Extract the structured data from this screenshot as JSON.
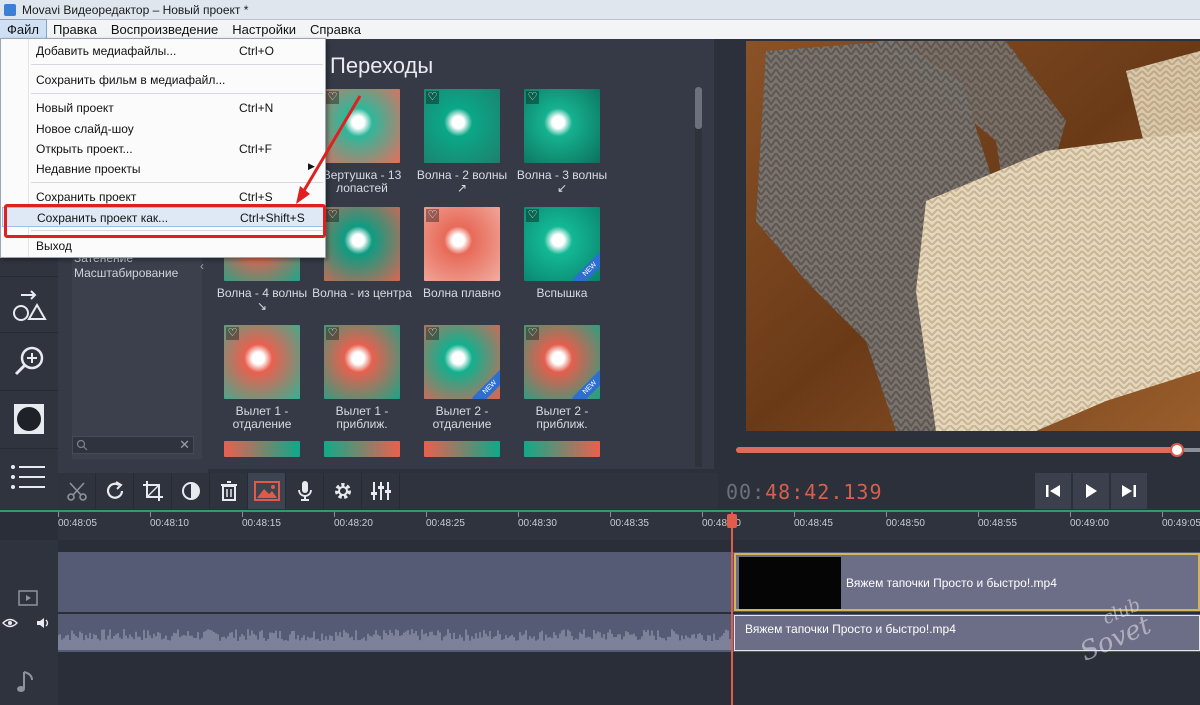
{
  "window": {
    "title": "Movavi Видеоредактор – Новый проект *"
  },
  "menubar": {
    "items": [
      "Файл",
      "Правка",
      "Воспроизведение",
      "Настройки",
      "Справка"
    ]
  },
  "file_menu": {
    "items": [
      {
        "label": "Добавить медиафайлы...",
        "shortcut": "Ctrl+O"
      },
      {
        "label": "Сохранить фильм в медиафайл...",
        "shortcut": ""
      },
      {
        "label": "Новый проект",
        "shortcut": "Ctrl+N"
      },
      {
        "label": "Новое слайд-шоу",
        "shortcut": ""
      },
      {
        "label": "Открыть проект...",
        "shortcut": "Ctrl+F"
      },
      {
        "label": "Недавние проекты",
        "shortcut": "",
        "submenu": true
      },
      {
        "label": "Сохранить проект",
        "shortcut": "Ctrl+S"
      },
      {
        "label": "Сохранить проект как...",
        "shortcut": "Ctrl+Shift+S",
        "highlighted": true
      },
      {
        "label": "Выход",
        "shortcut": ""
      }
    ]
  },
  "categories": {
    "items": [
      "Затенение",
      "Масштабирование"
    ]
  },
  "transitions": {
    "title": "Переходы",
    "tiles": [
      {
        "caption": "Вертушка - 13 лопастей",
        "is_new": false
      },
      {
        "caption": "Волна - 2 волны ↗",
        "is_new": false
      },
      {
        "caption": "Волна - 3 волны ↙",
        "is_new": false
      },
      {
        "caption": "Волна - 4 волны ↘",
        "is_new": false
      },
      {
        "caption": "Волна - из центра",
        "is_new": false
      },
      {
        "caption": "Волна плавно",
        "is_new": false
      },
      {
        "caption": "Вспышка",
        "is_new": true
      },
      {
        "caption": "Вылет 1 - отдаление",
        "is_new": false
      },
      {
        "caption": "Вылет 1 - приближ.",
        "is_new": false
      },
      {
        "caption": "Вылет 2 - отдаление",
        "is_new": true
      },
      {
        "caption": "Вылет 2 - приближ.",
        "is_new": true
      }
    ]
  },
  "player": {
    "timecode_dim": "00:",
    "timecode_lit": "48:42.139",
    "progress": 0.99
  },
  "toolbar": {
    "buttons": [
      "cut-icon",
      "rotate-icon",
      "crop-icon",
      "color-adjust-icon",
      "delete-icon",
      "image-icon",
      "mic-icon",
      "gear-icon",
      "equalizer-icon"
    ]
  },
  "timeline": {
    "ticks": [
      "00:48:05",
      "00:48:10",
      "00:48:15",
      "00:48:20",
      "00:48:25",
      "00:48:30",
      "00:48:35",
      "00:48:40",
      "00:48:45",
      "00:48:50",
      "00:48:55",
      "00:49:00",
      "00:49:05"
    ],
    "video_clip_name": "Вяжем тапочки Просто и быстро!.mp4",
    "audio_clip_name": "Вяжем тапочки Просто и быстро!.mp4"
  },
  "watermark": {
    "line1": "club",
    "line2": "Sovet"
  },
  "colors": {
    "accent": "#e35b4a",
    "timeline_green": "#2f9d6a",
    "highlight_box": "#e01f1f"
  }
}
